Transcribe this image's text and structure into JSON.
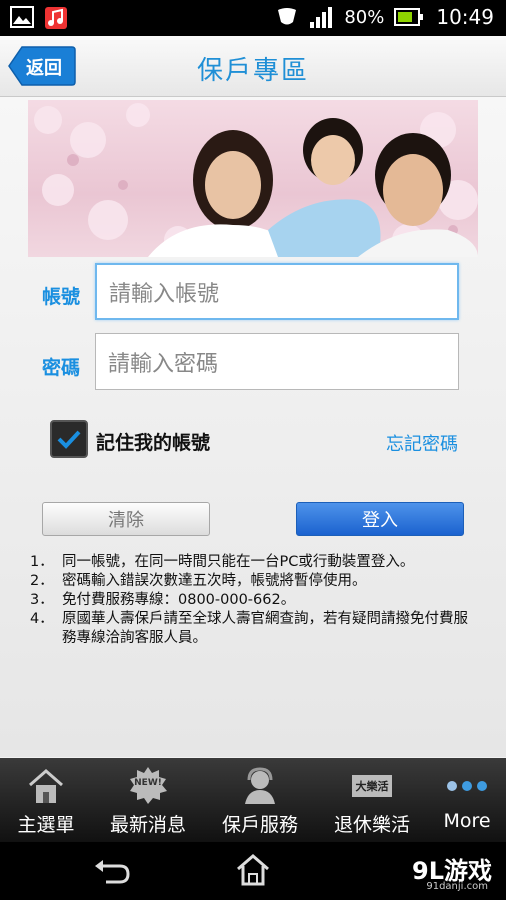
{
  "status_bar": {
    "battery": "80%",
    "time": "10:49"
  },
  "header": {
    "back_label": "返回",
    "title": "保戶專區"
  },
  "login": {
    "account_label": "帳號",
    "account_placeholder": "請輸入帳號",
    "password_label": "密碼",
    "password_placeholder": "請輸入密碼",
    "remember_label": "記住我的帳號",
    "remember_checked": true,
    "forgot_label": "忘記密碼",
    "clear_label": "清除",
    "login_label": "登入"
  },
  "notes": [
    {
      "num": "1．",
      "text": "同一帳號，在同一時間只能在一台PC或行動裝置登入。"
    },
    {
      "num": "2．",
      "text": "密碼輸入錯誤次數達五次時，帳號將暫停使用。"
    },
    {
      "num": "3．",
      "text": "免付費服務專線：0800-000-662。"
    },
    {
      "num": "4．",
      "text": "原國華人壽保戶請至全球人壽官網查詢，若有疑問請撥免付費服務專線洽詢客服人員。"
    }
  ],
  "tabs": [
    {
      "label": "主選單",
      "icon": "home-icon"
    },
    {
      "label": "最新消息",
      "icon": "new-badge-icon"
    },
    {
      "label": "保戶服務",
      "icon": "customer-service-icon"
    },
    {
      "label": "退休樂活",
      "icon": "retirement-icon"
    },
    {
      "label": "More",
      "icon": "more-dots-icon"
    }
  ],
  "retirement_badge": "大樂活",
  "new_badge": "NEW!",
  "watermark": {
    "brand": "9L游戏",
    "site": "91danji.com"
  },
  "colors": {
    "accent": "#1a8fe0",
    "login_button": "#1b62cf",
    "back_button": "#1a7fd6"
  }
}
